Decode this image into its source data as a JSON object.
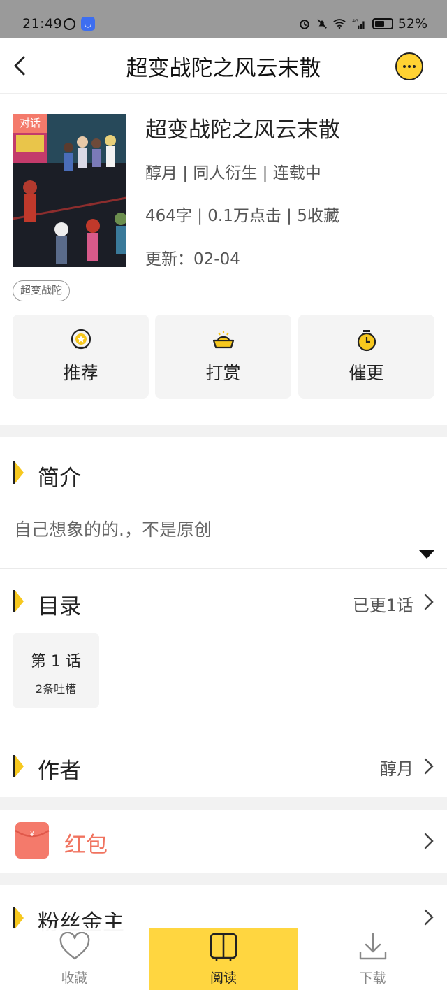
{
  "status_bar": {
    "time": "21:49",
    "signal_label": "4G",
    "battery": "52%"
  },
  "header": {
    "title": "超变战陀之风云末散"
  },
  "book": {
    "cover_tag": "对话",
    "title": "超变战陀之风云末散",
    "meta_line1": "醇月 | 同人衍生 | 连载中",
    "meta_line2": "464字 | 0.1万点击 | 5收藏",
    "update": "更新：02-04",
    "tag": "超变战陀"
  },
  "actions": [
    {
      "label": "推荐",
      "icon": "medal-icon"
    },
    {
      "label": "打赏",
      "icon": "gold-ingot-icon"
    },
    {
      "label": "催更",
      "icon": "timer-icon"
    }
  ],
  "intro": {
    "title": "简介",
    "text": "自己想象的的.，不是原创"
  },
  "catalog": {
    "title": "目录",
    "right_text": "已更1话",
    "chapters": [
      {
        "title": "第 1 话",
        "comments": "2条吐槽"
      }
    ]
  },
  "author": {
    "title": "作者",
    "name": "醇月"
  },
  "red_packet": {
    "label": "红包"
  },
  "fans": {
    "title": "粉丝金主"
  },
  "bottom_tabs": [
    {
      "label": "收藏",
      "icon": "heart-icon"
    },
    {
      "label": "阅读",
      "icon": "book-icon"
    },
    {
      "label": "下载",
      "icon": "download-icon"
    }
  ],
  "colors": {
    "accent_yellow": "#ffd640",
    "marker_yellow": "#f7c81e",
    "red_packet": "#f0735f",
    "cover_tag": "#f47a6b"
  }
}
